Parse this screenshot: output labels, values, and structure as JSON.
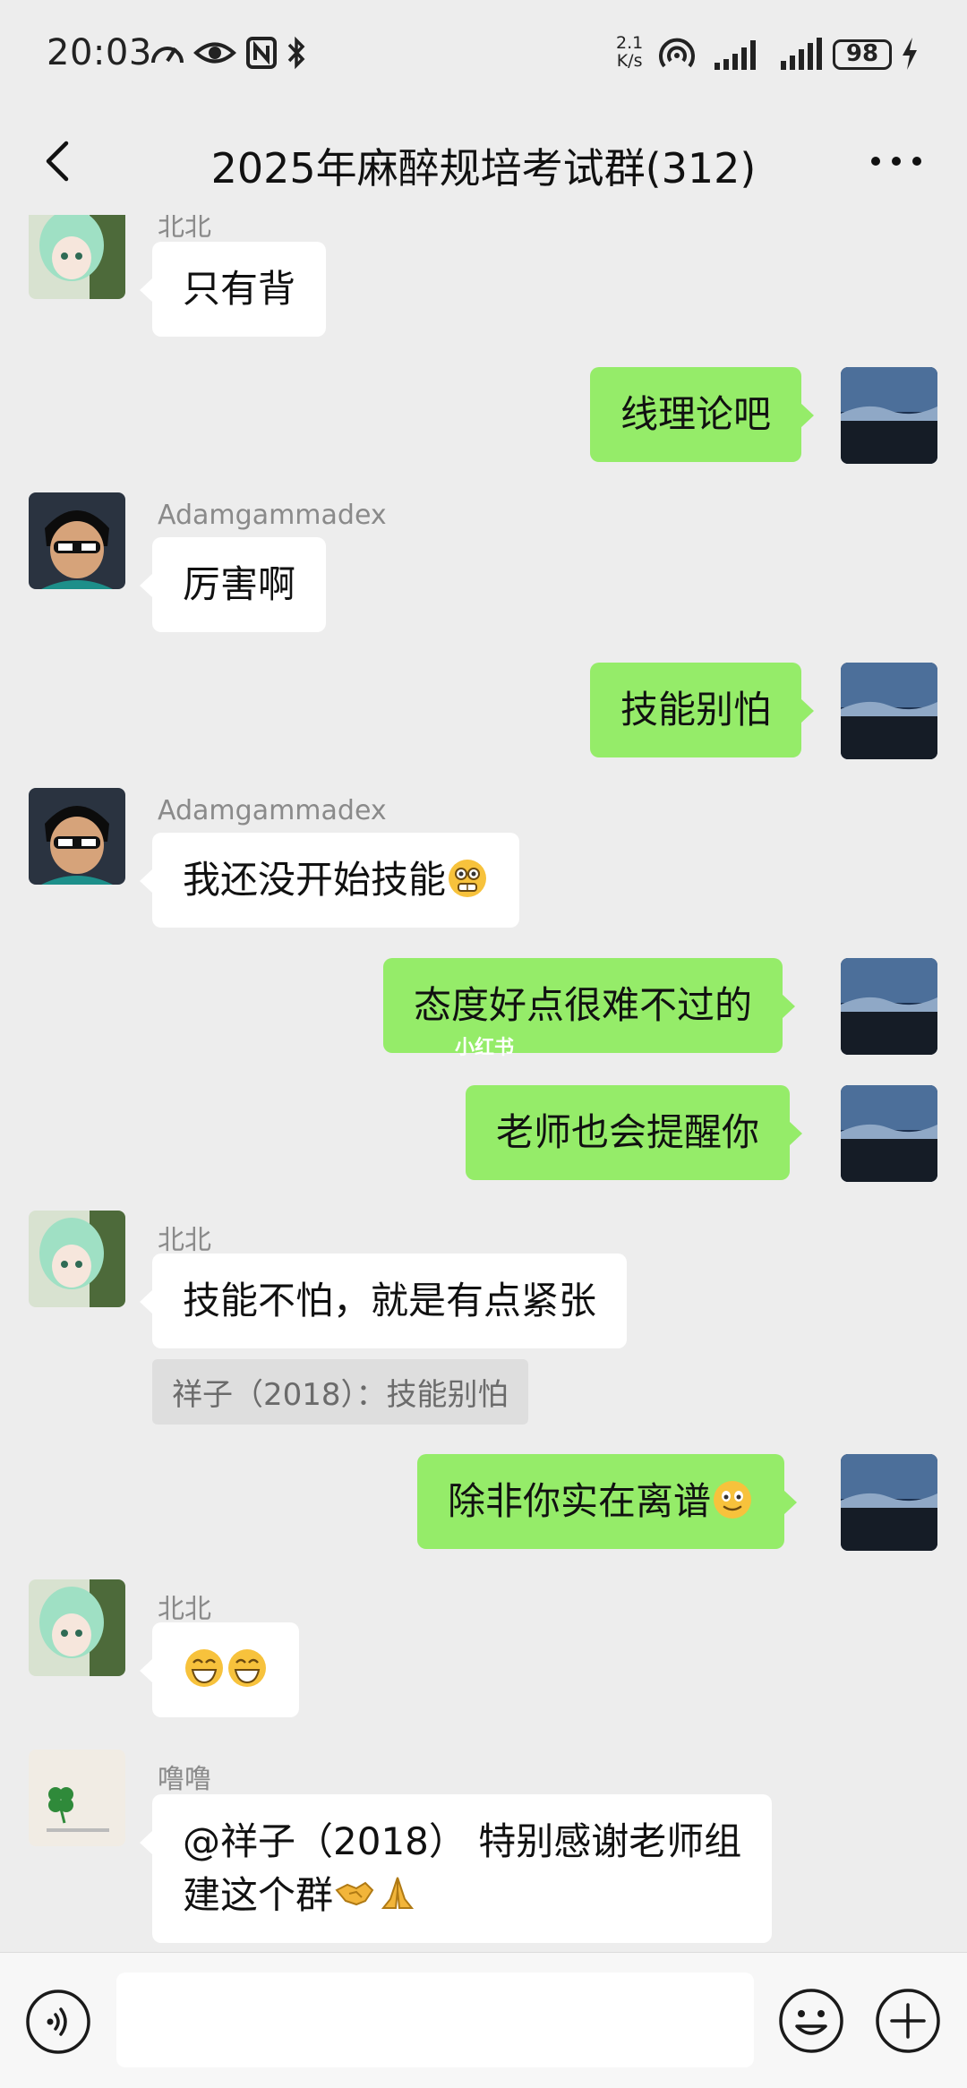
{
  "status_bar": {
    "time": "20:03",
    "net_speed_value": "2.1",
    "net_speed_unit": "K/s",
    "battery": "98"
  },
  "header": {
    "title": "2025年麻醉规培考试群(312)"
  },
  "messages": [
    {
      "side": "left",
      "sender": "北北",
      "text": "只有背"
    },
    {
      "side": "right",
      "text": "线理论吧"
    },
    {
      "side": "left",
      "sender": "Adamgammadex",
      "text": "厉害啊"
    },
    {
      "side": "right",
      "text": "技能别怕"
    },
    {
      "side": "left",
      "sender": "Adamgammadex",
      "text": "我还没开始技能",
      "emoji": "grimace-emoji"
    },
    {
      "side": "right",
      "text": "态度好点很难不过的"
    },
    {
      "side": "right",
      "text": "老师也会提醒你"
    },
    {
      "side": "left",
      "sender": "北北",
      "text": "技能不怕，就是有点紧张",
      "quote": "祥子（2018）：技能别怕"
    },
    {
      "side": "right",
      "text": "除非你实在离谱",
      "emoji": "smile-emoji"
    },
    {
      "side": "left",
      "sender": "北北",
      "emoji": "grin-emoji x2"
    },
    {
      "side": "left",
      "sender": "噜噜",
      "text_line1": "@祥子（2018） 特别感谢老师组",
      "text_line2": "建这个群",
      "emoji": "handshake-emoji, pray-emoji"
    }
  ],
  "watermark": "小红书",
  "colors": {
    "background": "#ededed",
    "bubble_self": "#95ec69",
    "bubble_other": "#ffffff"
  }
}
